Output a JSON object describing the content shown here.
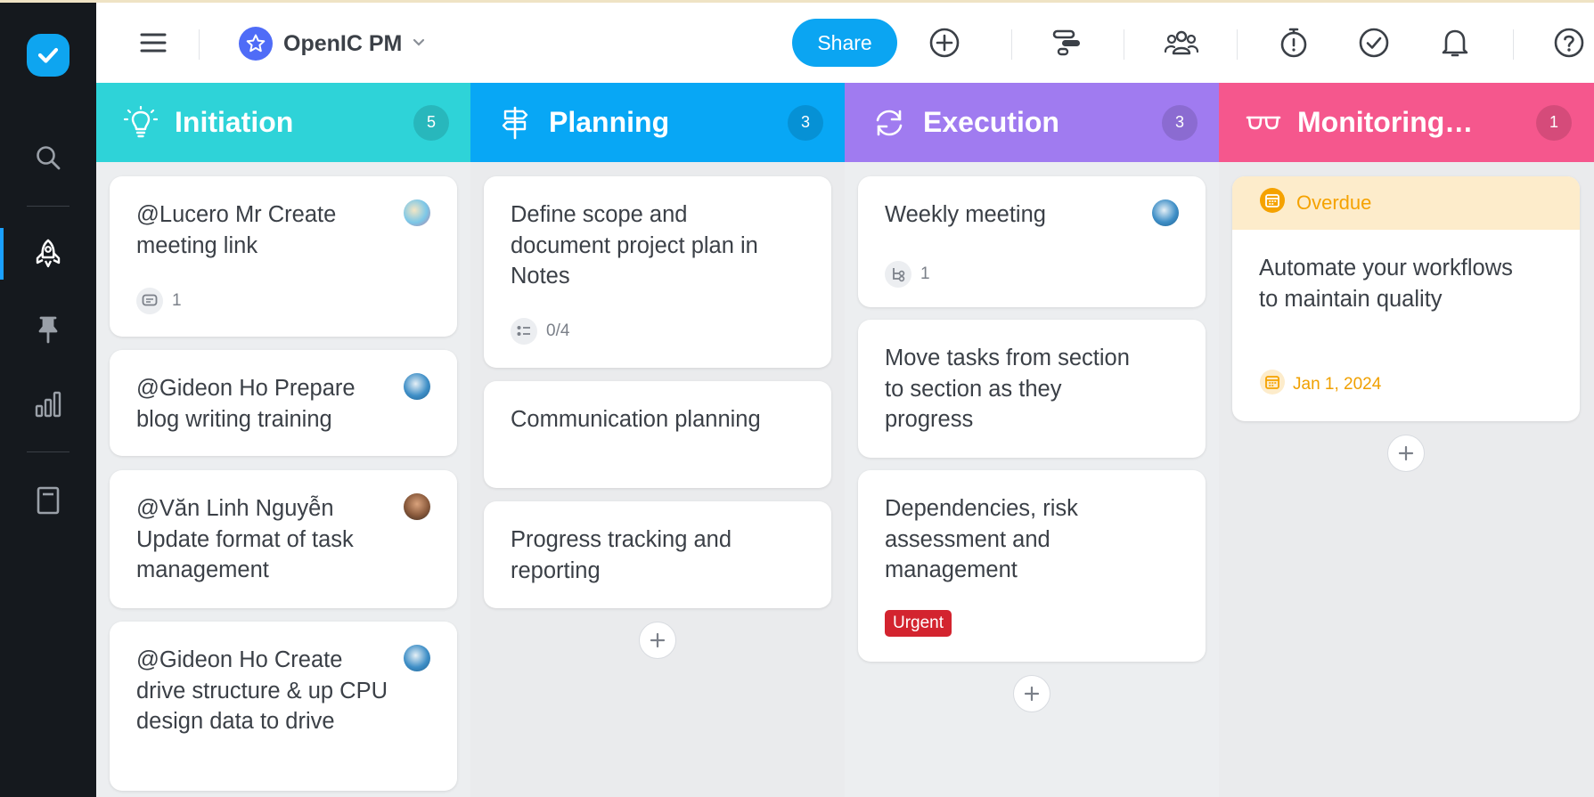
{
  "app": {
    "project_name": "OpenIC PM",
    "share_label": "Share"
  },
  "colors": {
    "rail_bg": "#15191e",
    "brand_blue": "#0ba5f2",
    "initiation": "#2ed3d8",
    "planning": "#08a7f5",
    "execution": "#a07bf0",
    "monitoring": "#f5578d",
    "urgent": "#d3242f",
    "overdue": "#f5a200"
  },
  "rail_icons": [
    "checkmark-logo-icon",
    "search-icon",
    "rocket-icon",
    "pin-icon",
    "bar-chart-icon",
    "notebook-icon"
  ],
  "toolbar_icons": [
    "menu-icon",
    "add-icon",
    "timeline-icon",
    "team-icon",
    "timer-icon",
    "check-circle-icon",
    "bell-icon",
    "help-icon"
  ],
  "columns": [
    {
      "title": "Initiation",
      "count": "5",
      "icon": "lightbulb-icon",
      "cards": [
        {
          "text": "@Lucero Mr Create meeting link",
          "meta": "1",
          "meta_icon": "comment-icon"
        },
        {
          "text": "@Gideon Ho Prepare blog writing training"
        },
        {
          "text": "@Văn Linh Nguyễn Update format of task management"
        },
        {
          "text": "@Gideon Ho Create drive structure & up CPU design data to drive"
        }
      ]
    },
    {
      "title": "Planning",
      "count": "3",
      "icon": "signpost-icon",
      "cards": [
        {
          "text": "Define scope and document project plan in Notes",
          "meta": "0/4",
          "meta_icon": "checklist-icon"
        },
        {
          "text": "Communication planning"
        },
        {
          "text": "Progress tracking and reporting"
        }
      ]
    },
    {
      "title": "Execution",
      "count": "3",
      "icon": "refresh-icon",
      "cards": [
        {
          "text": "Weekly meeting",
          "meta": "1",
          "meta_icon": "subtask-icon"
        },
        {
          "text": "Move tasks from section to section as they progress"
        },
        {
          "text": "Dependencies, risk assessment and management",
          "tag": "Urgent"
        }
      ]
    },
    {
      "title": "Monitoring…",
      "count": "1",
      "icon": "glasses-icon",
      "cards": [
        {
          "status": "Overdue",
          "text": "Automate your workflows to maintain quality",
          "due": "Jan 1, 2024"
        }
      ]
    }
  ]
}
